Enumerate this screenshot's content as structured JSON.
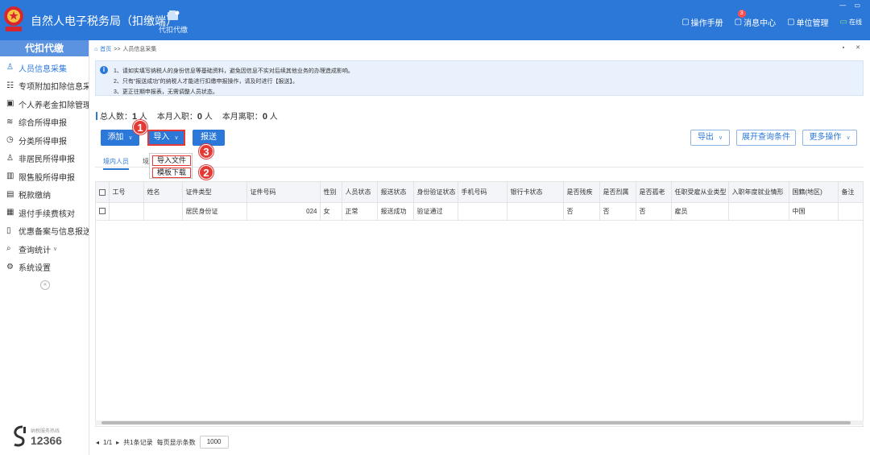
{
  "app": {
    "title": "自然人电子税务局（扣缴端）",
    "top_tab_label": "代扣代缴",
    "header_links": [
      {
        "label": "操作手册",
        "icon": "manual-icon"
      },
      {
        "label": "消息中心",
        "icon": "message-icon",
        "badge": "3"
      },
      {
        "label": "单位管理",
        "icon": "company-icon"
      },
      {
        "label": "在线",
        "icon": "online-icon"
      }
    ]
  },
  "sidebar": {
    "header": "代扣代缴",
    "items": [
      {
        "label": "人员信息采集",
        "icon": "person-icon",
        "active": true
      },
      {
        "label": "专项附加扣除信息采集",
        "icon": "list-icon"
      },
      {
        "label": "个人养老金扣除管理",
        "icon": "pension-icon"
      },
      {
        "label": "综合所得申报",
        "icon": "layers-icon"
      },
      {
        "label": "分类所得申报",
        "icon": "clock-icon"
      },
      {
        "label": "非居民所得申报",
        "icon": "user-outline-icon"
      },
      {
        "label": "限售股所得申报",
        "icon": "bar-chart-icon"
      },
      {
        "label": "税款缴纳",
        "icon": "wallet-icon"
      },
      {
        "label": "退付手续费核对",
        "icon": "refund-icon"
      },
      {
        "label": "优惠备案与信息报送",
        "icon": "document-icon",
        "has_arrow": true
      },
      {
        "label": "查询统计",
        "icon": "search-stats-icon",
        "has_arrow": true
      },
      {
        "label": "系统设置",
        "icon": "gear-icon"
      }
    ],
    "hotline_caption": "纳税服务热线",
    "hotline_number": "12366"
  },
  "breadcrumb": {
    "home": "首页",
    "separator": ">>",
    "current": "人员信息采集"
  },
  "notice": {
    "lines": [
      "1、请如实填写纳税人的身份信息等基础资料，避免因信息不实对后续其他业务的办理造成影响。",
      "2、只有“报送成功”的纳税人才能进行扣缴申报操作，请及时进行【报送】。",
      "3、更正往期申报表，无需调整人员状态。"
    ]
  },
  "stats": {
    "total_label": "总人数：",
    "total_value": "1",
    "total_unit": "人",
    "hire_label": "本月入职：",
    "hire_value": "0",
    "hire_unit": "人",
    "leave_label": "本月离职：",
    "leave_value": "0",
    "leave_unit": "人"
  },
  "toolbar": {
    "add": "添加",
    "import": "导入",
    "submit": "报送",
    "export": "导出",
    "expand_query": "展开查询条件",
    "more": "更多操作"
  },
  "import_menu": {
    "import_file": "导入文件",
    "template_download": "模板下载"
  },
  "annotations": [
    "1",
    "2",
    "3"
  ],
  "subtabs": {
    "domestic": "境内人员",
    "foreign": "境"
  },
  "table": {
    "columns": [
      "工号",
      "姓名",
      "证件类型",
      "证件号码",
      "性别",
      "人员状态",
      "报送状态",
      "身份验证状态",
      "手机号码",
      "银行卡状态",
      "是否残疾",
      "是否烈属",
      "是否孤老",
      "任职受雇从业类型",
      "入职年度就业情形",
      "国籍(地区)",
      "备注"
    ],
    "rows": [
      [
        "",
        "",
        "居民身份证",
        "024",
        "女",
        "正常",
        "报送成功",
        "验证通过",
        "",
        "",
        "否",
        "否",
        "否",
        "雇员",
        "",
        "中国",
        ""
      ]
    ]
  },
  "pager": {
    "page": "1/1",
    "total": "共1条记录",
    "per_page_label": "每页显示条数",
    "per_page_value": "1000"
  },
  "colors": {
    "primary": "#2b78d8",
    "annotation_red": "#e53935",
    "notice_bg": "#e8f1fc"
  }
}
